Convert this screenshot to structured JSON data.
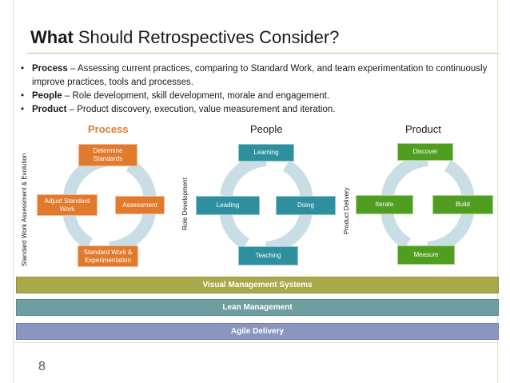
{
  "title": {
    "bold": "What",
    "rest": " Should Retrospectives Consider?"
  },
  "bullets": [
    {
      "term": "Process",
      "text": " – Assessing current practices, comparing to Standard Work, and team experimentation to continuously improve practices, tools and processes."
    },
    {
      "term": "People",
      "text": " – Role development, skill development, morale and engagement."
    },
    {
      "term": "Product",
      "text": " – Product discovery, execution, value measurement and iteration."
    }
  ],
  "process": {
    "title": "Process",
    "axis_label": "Standard Work Assessment & Evolution",
    "top": "Determine Standards",
    "left": "Adjust Standard Work",
    "right": "Assessment",
    "bottom": "Standard Work & Experimentation",
    "color": "#e27a2e"
  },
  "people": {
    "title": "People",
    "axis_label": "Role Development",
    "top": "Learning",
    "left": "Leading",
    "right": "Doing",
    "bottom": "Teaching",
    "color": "#2e8f9e"
  },
  "product": {
    "title": "Product",
    "axis_label": "Product Delivery",
    "top": "Discover",
    "left": "Iterate",
    "right": "Build",
    "bottom": "Measure",
    "color": "#4f9e1f"
  },
  "bands": {
    "visual": "Visual Management Systems",
    "lean": "Lean Management",
    "agile": "Agile Delivery"
  },
  "page_number": "8",
  "colors": {
    "process_title": "#e27a2e",
    "arrow": "#c9dde4",
    "band_visual": "#a7a94a",
    "band_lean": "#6f9ea0",
    "band_agile": "#8b96c0"
  }
}
